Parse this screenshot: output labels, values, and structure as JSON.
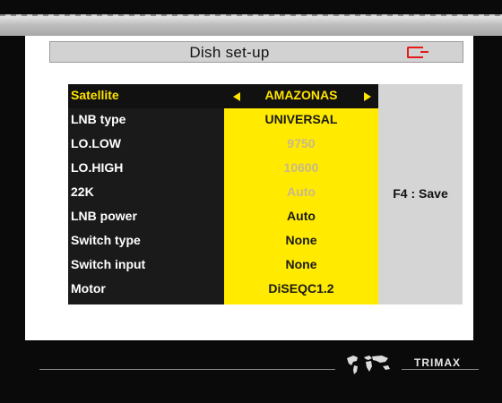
{
  "screen": {
    "title": "Dish set-up"
  },
  "menu": {
    "items": [
      {
        "label": "Satellite",
        "value": "AMAZONAS",
        "state": "selected"
      },
      {
        "label": "LNB type",
        "value": "UNIVERSAL",
        "state": "normal"
      },
      {
        "label": "LO.LOW",
        "value": "9750",
        "state": "disabled"
      },
      {
        "label": "LO.HIGH",
        "value": "10600",
        "state": "disabled"
      },
      {
        "label": "22K",
        "value": "Auto",
        "state": "disabled"
      },
      {
        "label": "LNB power",
        "value": "Auto",
        "state": "normal"
      },
      {
        "label": "Switch type",
        "value": "None",
        "state": "normal"
      },
      {
        "label": "Switch input",
        "value": "None",
        "state": "normal"
      },
      {
        "label": "Motor",
        "value": "DiSEQC1.2",
        "state": "normal"
      }
    ]
  },
  "hint": {
    "save": "F4 : Save"
  },
  "footer": {
    "brand": "TRIMAX",
    "logo_icon": "world-map-icon"
  },
  "colors": {
    "highlight": "#ffe400",
    "exit_icon": "#e21b1b"
  }
}
